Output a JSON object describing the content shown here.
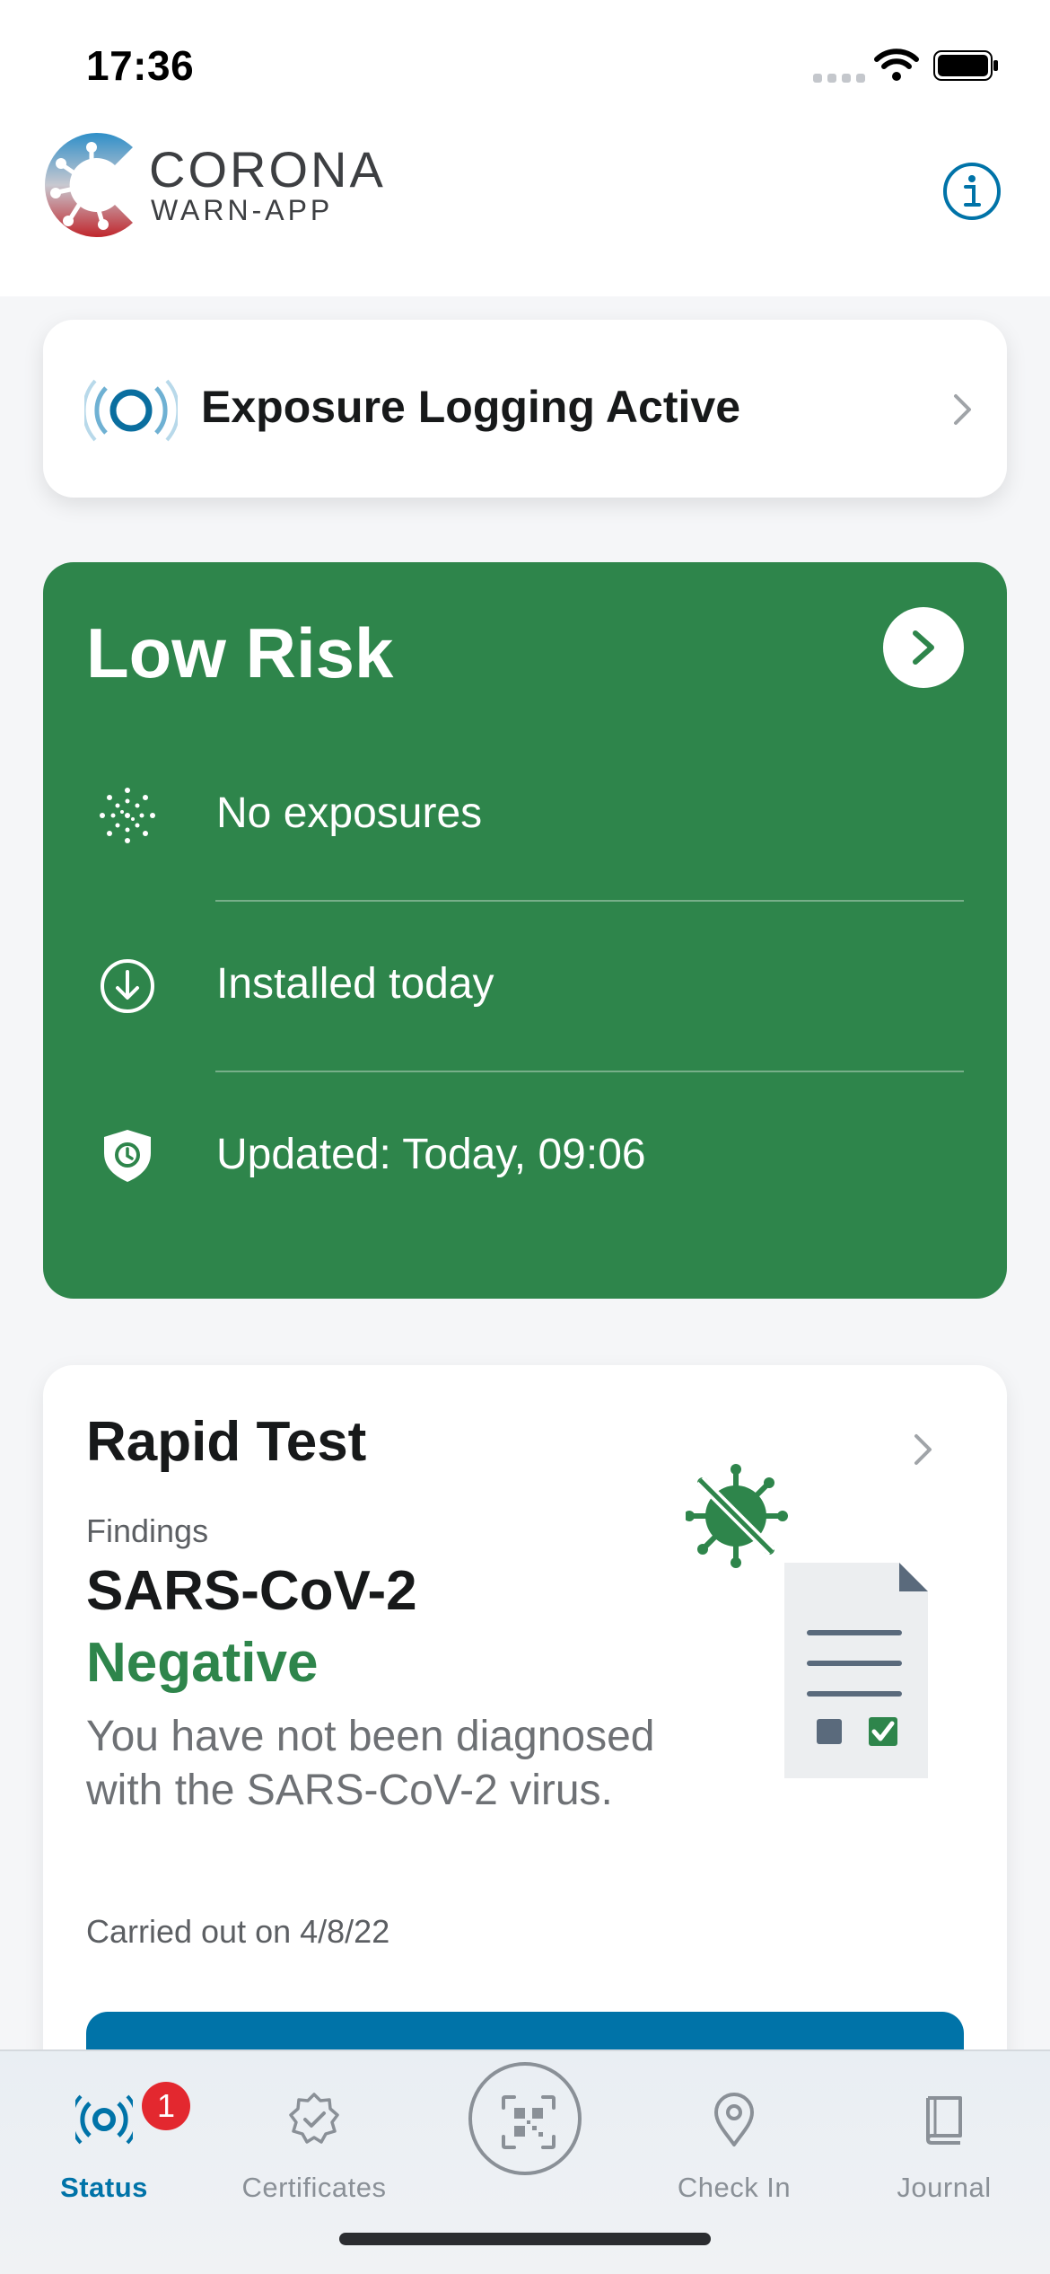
{
  "status_bar": {
    "time": "17:36"
  },
  "header": {
    "brand_title": "CORONA",
    "brand_subtitle": "WARN-APP",
    "info_icon": "info-icon"
  },
  "exposure_logging": {
    "label": "Exposure Logging Active",
    "icon": "exposure-logging-icon"
  },
  "risk": {
    "title": "Low Risk",
    "color": "#2e854b",
    "rows": [
      {
        "icon": "virus-dots-icon",
        "text": "No exposures"
      },
      {
        "icon": "download-circle-icon",
        "text": "Installed today"
      },
      {
        "icon": "shield-clock-icon",
        "text": "Updated: Today, 09:06"
      }
    ]
  },
  "test": {
    "title": "Rapid Test",
    "findings_label": "Findings",
    "virus": "SARS-CoV-2",
    "result": "Negative",
    "result_color": "#2e854b",
    "description": "You have not been diagnosed with the SARS-CoV-2 virus.",
    "carried_out": "Carried out on 4/8/22"
  },
  "tabs": [
    {
      "label": "Status",
      "icon": "status-broadcast-icon",
      "active": true,
      "badge": "1"
    },
    {
      "label": "Certificates",
      "icon": "certificate-badge-icon",
      "active": false
    },
    {
      "label": "",
      "icon": "qr-scan-icon",
      "active": false
    },
    {
      "label": "Check In",
      "icon": "location-pin-icon",
      "active": false
    },
    {
      "label": "Journal",
      "icon": "journal-book-icon",
      "active": false
    }
  ],
  "colors": {
    "accent": "#0073a8",
    "badge": "#e3282f"
  }
}
